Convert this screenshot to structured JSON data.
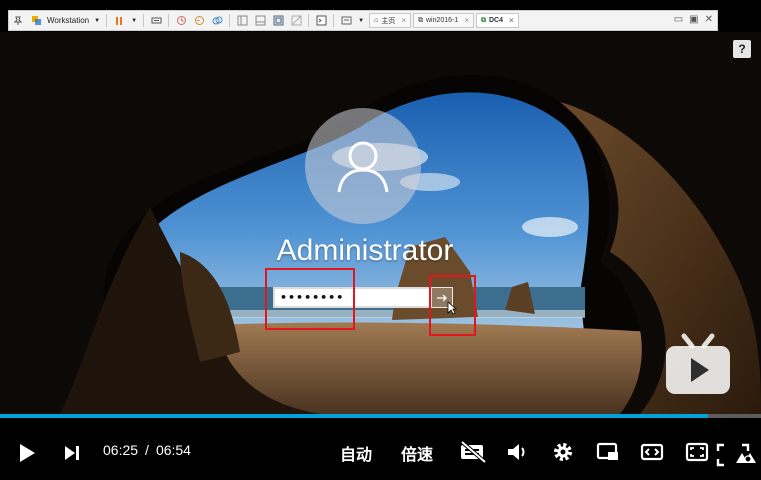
{
  "vmware": {
    "product_menu": "Workstation",
    "tabs": [
      {
        "label": "主页",
        "active": false
      },
      {
        "label": "win2016-1",
        "active": false
      },
      {
        "label": "DC4",
        "active": true
      }
    ]
  },
  "login": {
    "username": "Administrator",
    "password_masked": "••••••••",
    "help_label": "?"
  },
  "player": {
    "current_time": "06:25",
    "separator": "/",
    "total_time": "06:54",
    "progress": 0.93,
    "auto_label": "自动",
    "speed_label": "倍速",
    "accent_color": "#00a1d6"
  },
  "annotations": {
    "highlight_color": "#e3161b"
  }
}
